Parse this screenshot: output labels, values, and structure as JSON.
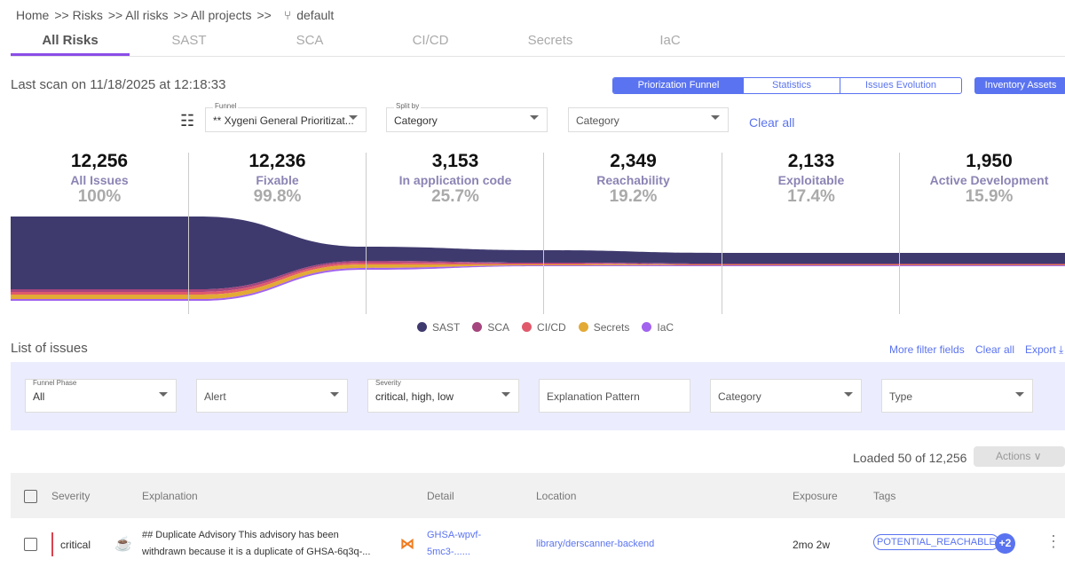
{
  "breadcrumb": {
    "items": [
      "Home",
      ">> Risks",
      ">> All risks",
      ">> All projects",
      ">>"
    ],
    "branch": "default"
  },
  "tabs": [
    "All Risks",
    "SAST",
    "SCA",
    "CI/CD",
    "Secrets",
    "IaC"
  ],
  "last_scan": "Last scan on 11/18/2025 at 12:18:33",
  "view_toggle": [
    "Priorization Funnel",
    "Statistics",
    "Issues Evolution"
  ],
  "inventory_button": "Inventory Assets",
  "controls": {
    "funnel_label": "Funnel",
    "funnel_value": "** Xygeni General Prioritizat...",
    "split_label": "Split by",
    "split_value": "Category",
    "category_value": "Category",
    "clear_all": "Clear all"
  },
  "funnel": {
    "stages": [
      {
        "count": "12,256",
        "label": "All Issues",
        "pct": "100%"
      },
      {
        "count": "12,236",
        "label": "Fixable",
        "pct": "99.8%"
      },
      {
        "count": "3,153",
        "label": "In application code",
        "pct": "25.7%"
      },
      {
        "count": "2,349",
        "label": "Reachability",
        "pct": "19.2%"
      },
      {
        "count": "2,133",
        "label": "Exploitable",
        "pct": "17.4%"
      },
      {
        "count": "1,950",
        "label": "Active Development",
        "pct": "15.9%"
      }
    ],
    "legend": [
      {
        "name": "SAST",
        "color": "#3f3a6e"
      },
      {
        "name": "SCA",
        "color": "#a5467e"
      },
      {
        "name": "CI/CD",
        "color": "#e05a6c"
      },
      {
        "name": "Secrets",
        "color": "#e3aa35"
      },
      {
        "name": "IaC",
        "color": "#a263ef"
      }
    ]
  },
  "issues": {
    "title": "List of issues",
    "more_filters": "More filter fields",
    "clear_all": "Clear all",
    "export": "Export",
    "filters": [
      {
        "label": "Funnel Phase",
        "value": "All"
      },
      {
        "label": "",
        "value": "Alert"
      },
      {
        "label": "Severity",
        "value": "critical, high, low"
      },
      {
        "label": "",
        "value": "Explanation Pattern"
      },
      {
        "label": "",
        "value": "Category"
      },
      {
        "label": "",
        "value": "Type"
      }
    ],
    "loaded": "Loaded 50 of 12,256",
    "actions": "Actions",
    "columns": [
      "Severity",
      "Explanation",
      "Detail",
      "Location",
      "Exposure",
      "Tags"
    ],
    "rows": [
      {
        "severity": "critical",
        "explanation_1": "## Duplicate Advisory This advisory has been",
        "explanation_2": "withdrawn because it is a duplicate of GHSA-6q3q-...",
        "detail_1": "GHSA-wpvf-",
        "detail_2": "5mc3-......",
        "location": "library/derscanner-backend",
        "exposure": "2mo 2w",
        "tag": "POTENTIAL_REACHABLE",
        "more_tags": "+2"
      }
    ]
  }
}
